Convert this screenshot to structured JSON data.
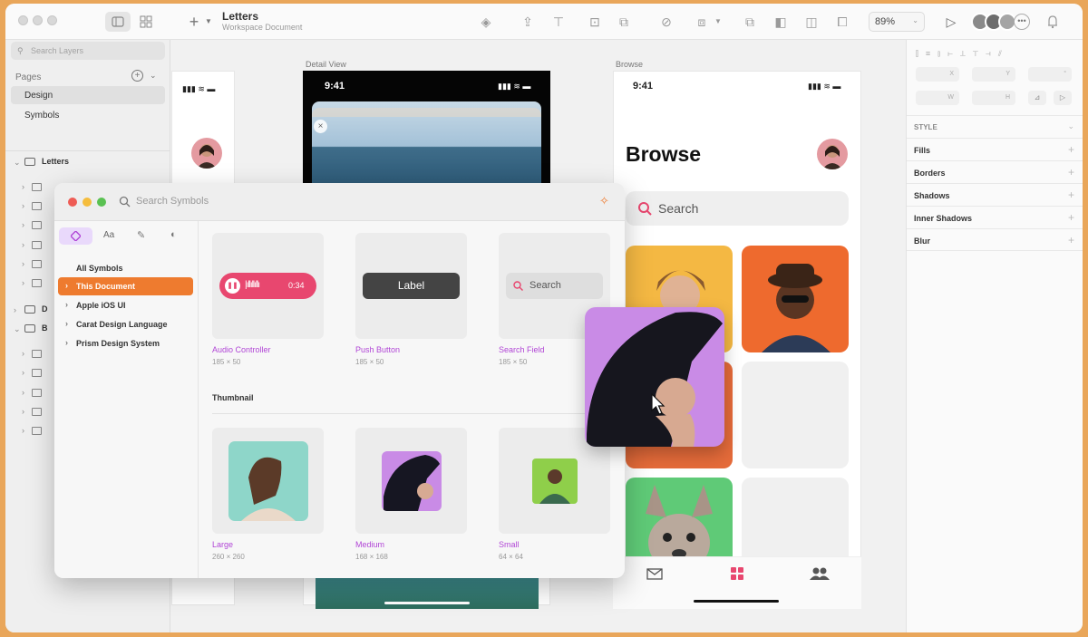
{
  "toolbar": {
    "doc_title": "Letters",
    "doc_subtitle": "Workspace Document",
    "add_label": "+",
    "zoom": "89%"
  },
  "sidebar": {
    "search_placeholder": "Search Layers",
    "pages_label": "Pages",
    "pages": [
      "Design",
      "Symbols"
    ],
    "group_letters": "Letters",
    "group_d": "D",
    "group_b": "B"
  },
  "canvas": {
    "detail_label": "Detail View",
    "browse_label": "Browse",
    "time": "9:41",
    "browse_title": "Browse",
    "browse_search": "Search"
  },
  "inspector": {
    "fields": [
      "X",
      "Y",
      "°",
      "W",
      "H"
    ],
    "style_label": "STYLE",
    "rows": [
      "Fills",
      "Borders",
      "Shadows",
      "Inner Shadows",
      "Blur"
    ]
  },
  "dialog": {
    "search_placeholder": "Search Symbols",
    "tab_text": "Aa",
    "tree": [
      "All Symbols",
      "This Document",
      "Apple iOS UI",
      "Carat Design Language",
      "Prism Design System"
    ],
    "section_thumbnail": "Thumbnail",
    "symbols": [
      {
        "name": "Audio Controller",
        "size": "185 × 50"
      },
      {
        "name": "Push Button",
        "size": "185 × 50"
      },
      {
        "name": "Search Field",
        "size": "185 × 50"
      },
      {
        "name": "Large",
        "size": "260 × 260"
      },
      {
        "name": "Medium",
        "size": "168 × 168"
      },
      {
        "name": "Small",
        "size": "64 × 64"
      }
    ],
    "audio_time": "0:34",
    "button_label": "Label",
    "search_field_label": "Search"
  },
  "colors": {
    "accent_orange": "#ee7b2f",
    "accent_purple": "#b146d6",
    "accent_pink": "#e8476f"
  }
}
